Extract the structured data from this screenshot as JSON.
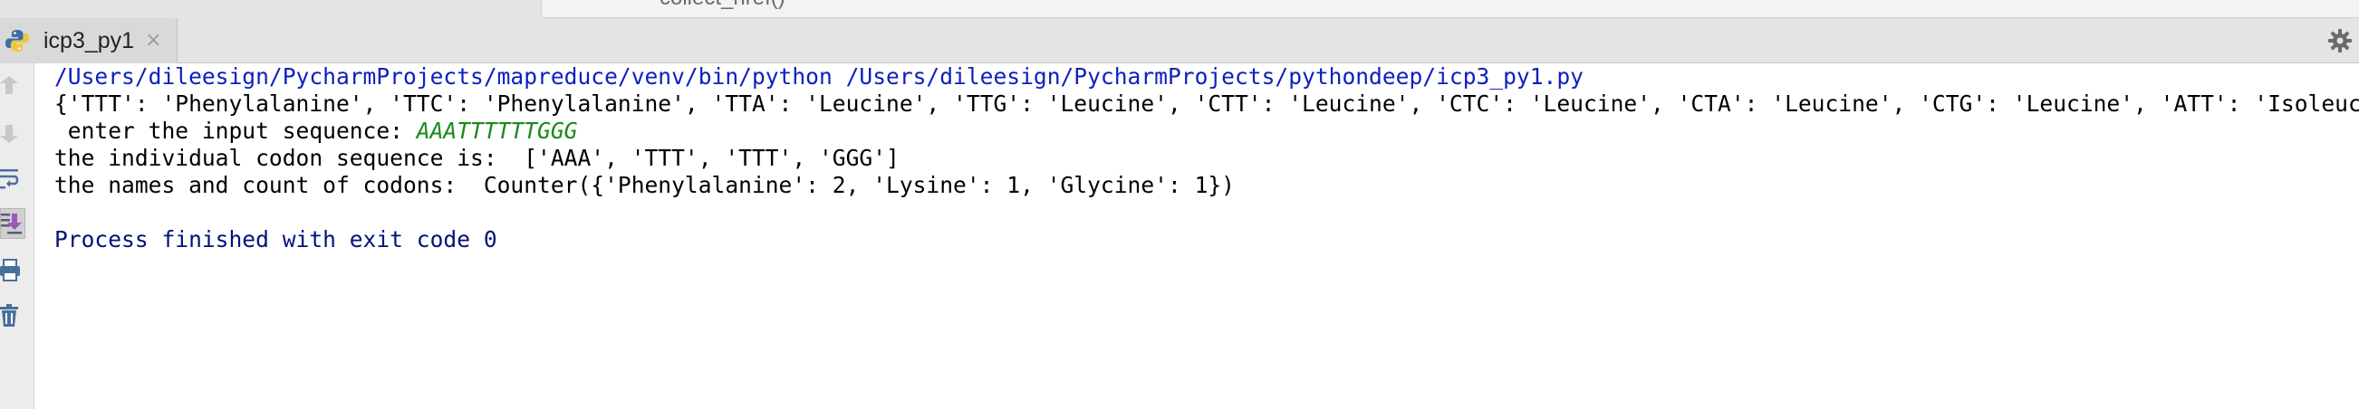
{
  "editor_peek_text": "collect_href()",
  "run_tab": {
    "label": "icp3_py1",
    "close_glyph": "×",
    "icon": "python-icon"
  },
  "toolbar_icons": [
    "up-arrow-icon",
    "down-arrow-icon",
    "soft-wrap-icon",
    "scroll-to-end-icon",
    "print-icon",
    "trash-icon"
  ],
  "settings_icon": "gear-icon",
  "console": {
    "command": "/Users/dileesign/PycharmProjects/mapreduce/venv/bin/python /Users/dileesign/PycharmProjects/pythondeep/icp3_py1.py",
    "codon_dict": "{'TTT': 'Phenylalanine', 'TTC': 'Phenylalanine', 'TTA': 'Leucine', 'TTG': 'Leucine', 'CTT': 'Leucine', 'CTC': 'Leucine', 'CTA': 'Leucine', 'CTG': 'Leucine', 'ATT': 'Isoleucine', 'ATC",
    "prompt": " enter the input sequence: ",
    "user_input": "AAATTTTTTGGG",
    "codon_sequence": "the individual codon sequence is:  ['AAA', 'TTT', 'TTT', 'GGG']",
    "codon_count": "the names and count of codons:  Counter({'Phenylalanine': 2, 'Lysine': 1, 'Glycine': 1})",
    "blank": "",
    "exit": "Process finished with exit code 0"
  },
  "colors": {
    "command": "#0c1fbf",
    "exit": "#00137a",
    "input": "#1c8a1c"
  }
}
